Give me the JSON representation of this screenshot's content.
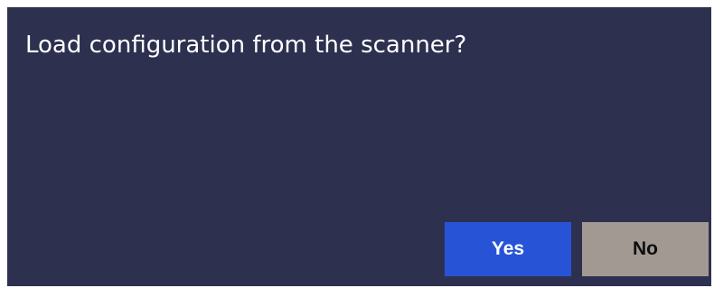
{
  "dialog": {
    "message": "Load configuration from the scanner?",
    "buttons": {
      "yes_label": "Yes",
      "no_label": "No"
    }
  },
  "colors": {
    "dialog_background": "#2d304f",
    "primary_button": "#2754d6",
    "secondary_button": "#a39993",
    "text_light": "#ffffff",
    "text_dark": "#0e0e0e"
  }
}
